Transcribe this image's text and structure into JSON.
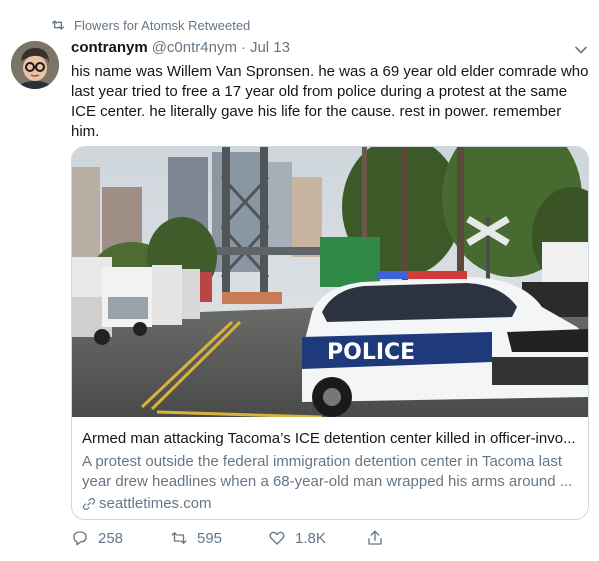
{
  "retweet": {
    "label": "Flowers for Atomsk Retweeted"
  },
  "tweet": {
    "display_name": "contranym",
    "handle": "@c0ntr4nym",
    "separator": "·",
    "date": "Jul 13",
    "text": "his name was Willem Van Spronsen. he was a 69 year old elder comrade who last year tried to free a 17 year old from police during a protest at the same ICE center. he literally gave his life for the cause. rest in power. remember him."
  },
  "card": {
    "title": "Armed man attacking Tacoma’s ICE detention center killed in officer-invo...",
    "description": "A protest outside the federal immigration detention center in Tacoma last year drew headlines when a 68-year-old man wrapped his arms around ...",
    "domain": "seattletimes.com",
    "image_text": "POLICE"
  },
  "actions": {
    "reply_count": "258",
    "retweet_count": "595",
    "like_count": "1.8K"
  },
  "colors": {
    "text_primary": "#14171a",
    "text_secondary": "#657786",
    "border": "#ccd6dd"
  },
  "icons": {
    "retweet_indicator": "retweet-icon",
    "menu": "chevron-down-icon",
    "link": "link-icon",
    "reply": "reply-icon",
    "retweet": "retweet-icon",
    "like": "heart-icon",
    "share": "share-icon"
  }
}
